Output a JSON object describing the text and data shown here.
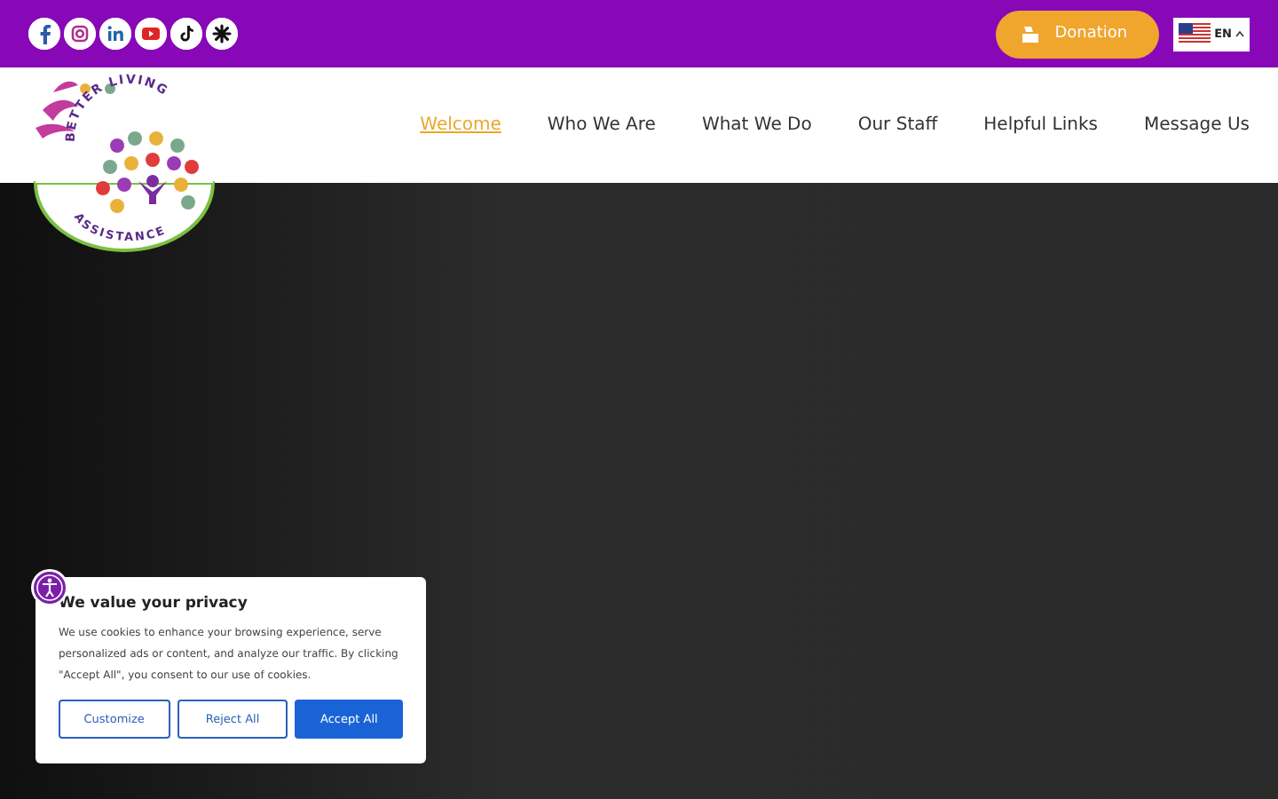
{
  "top_bar": {
    "social": [
      {
        "kind": "facebook"
      },
      {
        "kind": "instagram"
      },
      {
        "kind": "linkedin"
      },
      {
        "kind": "youtube"
      },
      {
        "kind": "tiktok"
      },
      {
        "kind": "other"
      }
    ],
    "donation_button": "Donation",
    "language": "EN"
  },
  "logo": {
    "top_text": "BETTER LIVING",
    "bottom_text": "ASSISTANCE"
  },
  "nav": [
    {
      "label": "Welcome",
      "selected": true
    },
    {
      "label": "Who We Are",
      "selected": false
    },
    {
      "label": "What We Do",
      "selected": false
    },
    {
      "label": "Our Staff",
      "selected": false
    },
    {
      "label": "Helpful Links",
      "selected": false
    },
    {
      "label": "Message Us",
      "selected": false
    }
  ],
  "cookie_banner": {
    "title": "We value your privacy",
    "text": "We use cookies to enhance your browsing experience, serve personalized ads or content, and analyze our traffic. By clicking \"Accept All\", you consent to our use of cookies.",
    "buttons": [
      {
        "label": "Customize",
        "kind": "outline"
      },
      {
        "label": "Reject All",
        "kind": "outline"
      },
      {
        "label": "Accept All",
        "kind": "primary"
      }
    ]
  }
}
